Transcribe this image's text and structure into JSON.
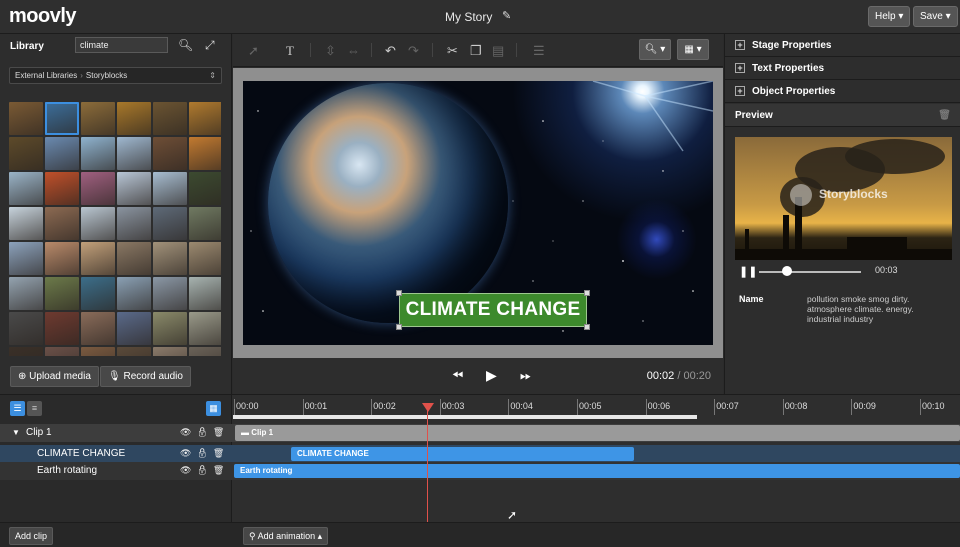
{
  "app": {
    "logo": "moovly",
    "project_title": "My Story",
    "help_label": "Help ▾",
    "save_label": "Save ▾"
  },
  "library": {
    "title": "Library",
    "search_value": "climate",
    "breadcrumb": [
      "External Libraries",
      "Storyblocks"
    ],
    "upload_label": "Upload media",
    "record_label": "Record audio",
    "thumb_colors": [
      "#7a5a34",
      "#3c6f9c",
      "#8c6c3a",
      "#a8782a",
      "#6b5432",
      "#b07a2e",
      "#5d4a2a",
      "#6a8ab0",
      "#8fb3cf",
      "#9fb8d0",
      "#6e4e36",
      "#c27a30",
      "#9ab4c8",
      "#c0502a",
      "#a06080",
      "#b8c6d6",
      "#a7bdd1",
      "#3c4a30",
      "#c7d3dc",
      "#8c6a52",
      "#b9c6d1",
      "#8a94a0",
      "#5e6a78",
      "#707a62",
      "#8ca2bc",
      "#b98a6a",
      "#c2a07a",
      "#8a7864",
      "#a2927a",
      "#9c8a70",
      "#94a3b0",
      "#6c7a4a",
      "#3c6e8a",
      "#8aa0b4",
      "#8b98a6",
      "#a7b3b0",
      "#4a4a4a",
      "#6e3a30",
      "#8a6c5a",
      "#5a6a8a",
      "#8a8a6a",
      "#9a9a8a",
      "#3a3028",
      "#6a5048",
      "#7a5a40",
      "#5a4a3a",
      "#8a7a6a",
      "#6a6258"
    ]
  },
  "toolbar": {
    "icons": [
      "pointer-icon",
      "text-tool-icon",
      "align-vertical-icon",
      "align-horizontal-icon",
      "undo-icon",
      "redo-icon",
      "cut-icon",
      "copy-icon",
      "paste-icon",
      "distribute-icon"
    ]
  },
  "stage": {
    "caption": "CLIMATE CHANGE"
  },
  "transport": {
    "current_time": "00:02",
    "separator": "/",
    "total_time": "00:20"
  },
  "properties": {
    "stage": "Stage Properties",
    "text": "Text Properties",
    "object": "Object Properties"
  },
  "preview": {
    "title": "Preview",
    "watermark": "Storyblocks",
    "time": "00:03",
    "progress_fraction": 0.27,
    "name_label": "Name",
    "name_value": "pollution smoke smog dirty. atmosphere climate. energy. industrial industry"
  },
  "timeline": {
    "ticks": [
      "00:00",
      "00:01",
      "00:02",
      "00:03",
      "00:04",
      "00:05",
      "00:06",
      "00:07",
      "00:08",
      "00:09",
      "00:10"
    ],
    "clip_label": "Clip 1",
    "rows": [
      {
        "label": "CLIMATE CHANGE",
        "bar_label": "CLIMATE CHANGE"
      },
      {
        "label": "Earth rotating",
        "bar_label": "Earth rotating"
      }
    ],
    "clip_bar_label": "Clip 1"
  },
  "bottom": {
    "add_clip_label": "Add clip",
    "add_animation_label": "Add animation ▴"
  }
}
